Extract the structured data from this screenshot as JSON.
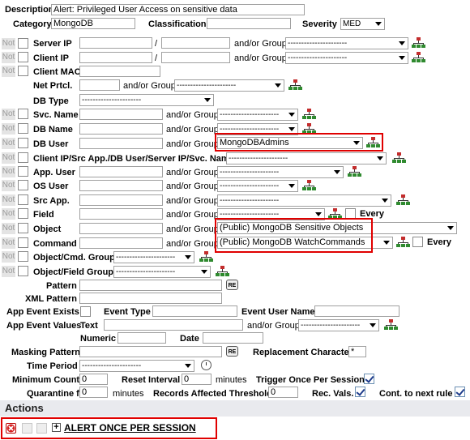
{
  "header": {
    "description_label": "Description",
    "description_value": "Alert: Privileged User Access on sensitive data",
    "category_label": "Category",
    "category_value": "MongoDB",
    "classification_label": "Classification",
    "classification_value": "",
    "severity_label": "Severity",
    "severity_value": "MED"
  },
  "common": {
    "not": "Not",
    "and_or_group": "and/or Group",
    "group_placeholder": "----------------------",
    "every": "Every",
    "slash": "/"
  },
  "rows": {
    "server_ip": "Server IP",
    "client_ip": "Client IP",
    "client_mac": "Client MAC",
    "net_prtcl": "Net Prtcl.",
    "db_type": "DB Type",
    "svc_name": "Svc. Name",
    "db_name": "DB Name",
    "db_user": "DB User",
    "db_user_group": "MongoDBAdmins",
    "client_ip_src": "Client IP/Src App./DB User/Server IP/Svc. Name",
    "app_user": "App. User",
    "os_user": "OS User",
    "src_app": "Src App.",
    "field": "Field",
    "object": "Object",
    "object_group": "(Public) MongoDB Sensitive Objects",
    "command": "Command",
    "command_group": "(Public) MongoDB WatchCommands",
    "object_cmd_group": "Object/Cmd. Group",
    "object_field_group": "Object/Field Group",
    "pattern": "Pattern",
    "xml_pattern": "XML Pattern",
    "app_event_exists": "App Event Exists",
    "event_type": "Event Type",
    "event_user_name": "Event User Name",
    "app_event_values": "App Event Values",
    "text": "Text",
    "numeric": "Numeric",
    "date": "Date",
    "masking_pattern": "Masking Pattern",
    "replacement_character": "Replacement Character",
    "replacement_value": "*",
    "time_period": "Time Period",
    "re": "RE"
  },
  "thresholds": {
    "minimum_count_label": "Minimum Count",
    "minimum_count_value": "0",
    "reset_interval_label": "Reset Interval",
    "reset_interval_value": "0",
    "minutes": "minutes",
    "trigger_once_label": "Trigger Once Per Session",
    "quarantine_label": "Quarantine for",
    "quarantine_value": "0",
    "records_affected_label": "Records Affected Threshold",
    "records_affected_value": "0",
    "rec_vals_label": "Rec. Vals.",
    "cont_next_rule_label": "Cont. to next rule"
  },
  "actions": {
    "title": "Actions",
    "item_label": "ALERT ONCE PER SESSION"
  },
  "colors": {
    "highlight": "#e00000",
    "actions_bg": "#e9eaee",
    "not_bg": "#e4e4e4"
  }
}
